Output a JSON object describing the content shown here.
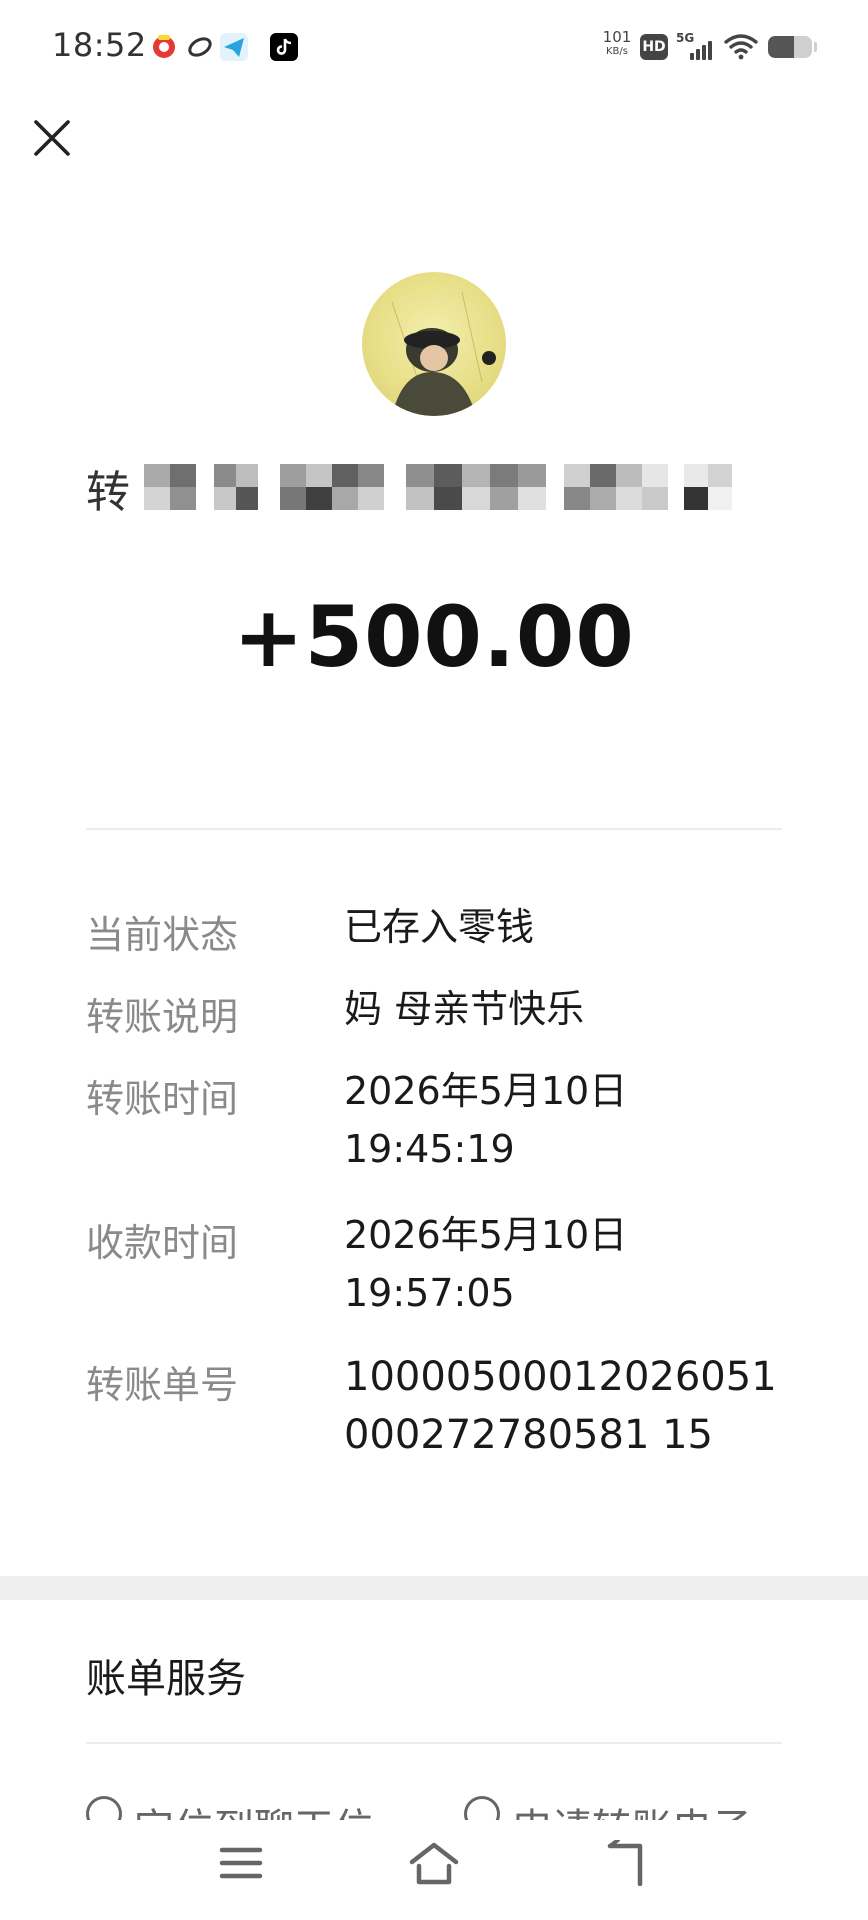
{
  "status_bar": {
    "time": "18:52",
    "net_speed": "101",
    "net_unit": "KB/s",
    "hd": "HD",
    "signal": "5G",
    "battery_level_percent": 60,
    "app_icons": [
      "camera-app-icon",
      "link-app-icon",
      "telegram-icon",
      "tiktok-icon"
    ]
  },
  "receipt": {
    "name_prefix": "转",
    "amount": "+500.00"
  },
  "details": [
    {
      "label": "当前状态",
      "value": "已存入零钱"
    },
    {
      "label": "转账说明",
      "value": "妈 母亲节快乐"
    },
    {
      "label": "转账时间",
      "value": "2026年5月10日",
      "value2": "19:45:19"
    },
    {
      "label": "收款时间",
      "value": "2026年5月10日",
      "value2": "19:57:05"
    },
    {
      "label": "转账单号",
      "value": "10000500012026051000272780581 15"
    }
  ],
  "bill_service": {
    "title": "账单服务",
    "items": [
      "定位到聊天位",
      "申请转账电子"
    ]
  },
  "nav": [
    "menu-icon",
    "home-icon",
    "back-icon"
  ],
  "colors": {
    "accent": "#1a1a1a",
    "label_gray": "#8a8a8a",
    "avatar_bg": "#e8df88"
  }
}
